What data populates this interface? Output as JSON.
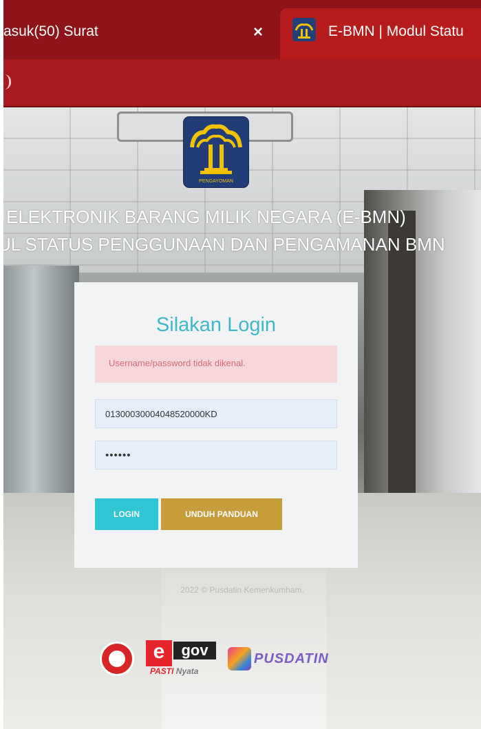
{
  "browser": {
    "tabs": [
      {
        "title": "asuk(50) Surat",
        "active": false
      },
      {
        "title": "E-BMN | Modul Statu",
        "active": true
      }
    ],
    "close_icon": "×"
  },
  "page": {
    "heading_line1": "ELEKTRONIK BARANG MILIK NEGARA (E-BMN)",
    "heading_line2": "UL STATUS PENGGUNAAN DAN PENGAMANAN BMN",
    "logo_caption": "PENGAYOMAN",
    "login": {
      "title": "Silakan Login",
      "alert": "Username/password tidak dikenal.",
      "username_value": "01300030004048520000KD",
      "password_value": "••••••",
      "login_button": "LOGIN",
      "guide_button": "UNDUH PANDUAN"
    },
    "footer": "2022 © Pusdatin Kemenkumham.",
    "badges": {
      "egov_e": "e",
      "egov_gov": "gov",
      "egov_sub_a": "PASTI",
      "egov_sub_b": "Nyata",
      "pusdatin": "PUSDATIN"
    }
  },
  "colors": {
    "browser_tab_bar": "#8e1419",
    "browser_toolbar": "#a81a1d",
    "title_accent": "#3fb6c9",
    "login_button": "#2ec5d4",
    "guide_button": "#c79d3c",
    "alert_bg": "#f7d7da",
    "logo_bg": "#223c78"
  }
}
